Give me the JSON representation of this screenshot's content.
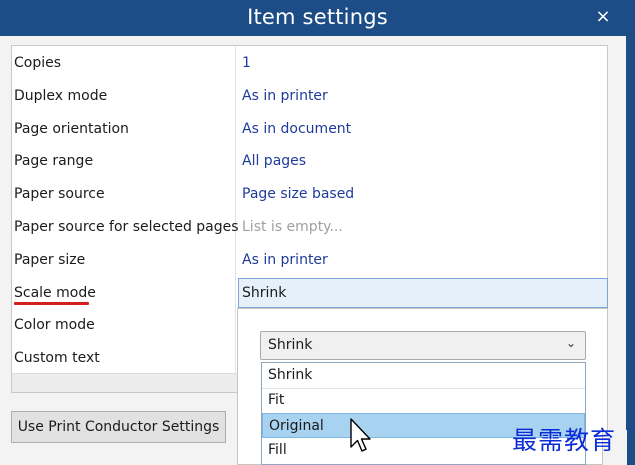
{
  "window": {
    "title": "Item settings",
    "close_glyph": "×"
  },
  "properties": [
    {
      "name": "Copies",
      "value": "1"
    },
    {
      "name": "Duplex mode",
      "value": "As in printer"
    },
    {
      "name": "Page orientation",
      "value": "As in document"
    },
    {
      "name": "Page range",
      "value": "All pages"
    },
    {
      "name": "Paper source",
      "value": "Page size based"
    },
    {
      "name": "Paper source for selected pages",
      "value": "List is empty..."
    },
    {
      "name": "Paper size",
      "value": "As in printer"
    },
    {
      "name": "Scale mode",
      "value": "Shrink"
    },
    {
      "name": "Color mode",
      "value": ""
    },
    {
      "name": "Custom text",
      "value": ""
    }
  ],
  "scale_dropdown": {
    "selected": "Shrink",
    "chevron_icon": "chevron-down-icon",
    "options": [
      "Shrink",
      "Fit",
      "Original",
      "Fill"
    ],
    "highlighted": "Original"
  },
  "buttons": {
    "use_print_conductor": "Use Print Conductor Settings"
  },
  "watermark": "最需教育",
  "colors": {
    "titlebar": "#1d4d86",
    "value_text": "#1f3b9c",
    "highlight": "#a8d3f0",
    "annotation_underline": "#d0201b"
  }
}
